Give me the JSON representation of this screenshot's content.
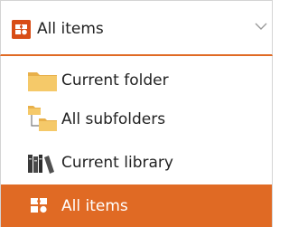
{
  "dropdown": {
    "selected_label": "All items",
    "selected_icon": "all-items-icon",
    "chevron_icon": "chevron-down-icon"
  },
  "menu": {
    "items": [
      {
        "label": "Current folder",
        "icon": "folder-icon",
        "selected": false
      },
      {
        "label": "All subfolders",
        "icon": "subfolders-icon",
        "selected": false
      },
      {
        "label": "Current library",
        "icon": "library-icon",
        "selected": false
      },
      {
        "label": "All items",
        "icon": "all-items-icon",
        "selected": true
      }
    ]
  },
  "colors": {
    "accent": "#e06a24",
    "icon_orange": "#d84d16",
    "folder_yellow": "#f5c969",
    "text": "#222222",
    "selected_text": "#ffffff",
    "border": "#d4d4d4"
  }
}
